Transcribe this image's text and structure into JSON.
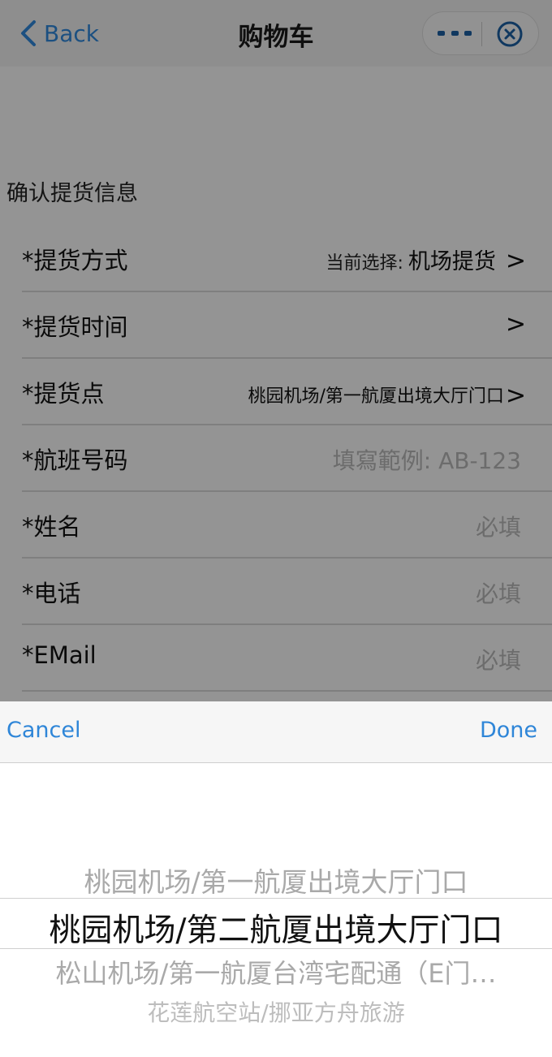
{
  "nav": {
    "back_label": "Back",
    "title": "购物车",
    "more_icon": "more-icon",
    "close_icon": "close-circle-icon"
  },
  "section_title": "确认提货信息",
  "form": {
    "rows": [
      {
        "label": "*提货方式",
        "hint": "当前选择:",
        "value": "机场提货",
        "arrow": ">"
      },
      {
        "label": "*提货时间",
        "arrow": ">"
      },
      {
        "label": "*提货点",
        "value": "桃园机场/第一航厦出境大厅门口",
        "arrow": ">"
      },
      {
        "label": "*航班号码",
        "placeholder": "填寫範例: AB-123"
      },
      {
        "label": "*姓名",
        "placeholder": "必填"
      },
      {
        "label": "*电话",
        "placeholder": "必填"
      },
      {
        "label": "*EMail",
        "placeholder": "必填"
      }
    ]
  },
  "picker": {
    "cancel_label": "Cancel",
    "done_label": "Done",
    "options": [
      "桃园机场/第一航厦出境大厅门口",
      "桃园机场/第二航厦出境大厅门口",
      "松山机场/第一航厦台湾宅配通（E门…",
      "花莲航空站/挪亚方舟旅游"
    ],
    "selected": "桃园机场/第二航厦出境大厅门口"
  },
  "colors": {
    "accent": "#2f86d8",
    "nav_icon": "#1b5ea0",
    "placeholder": "#b4b4b4"
  }
}
